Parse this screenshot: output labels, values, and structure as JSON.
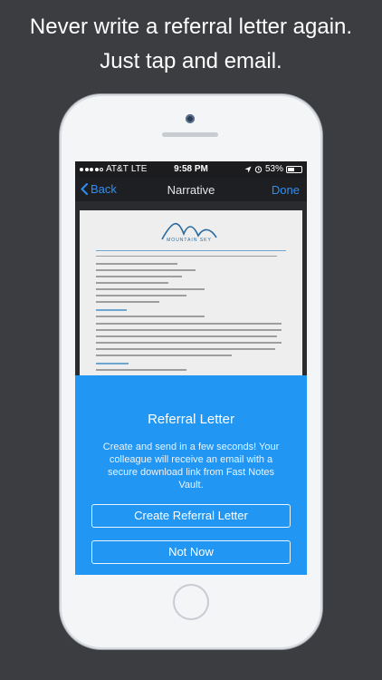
{
  "headline": {
    "line1": "Never write a referral letter again.",
    "line2": "Just tap and email."
  },
  "status_bar": {
    "carrier": "AT&T",
    "network": "LTE",
    "time": "9:58 PM",
    "battery": "53%",
    "battery_level_percent": 53
  },
  "nav": {
    "back_label": "Back",
    "title": "Narrative",
    "done_label": "Done"
  },
  "modal": {
    "title": "Referral Letter",
    "body": "Create and send in a few seconds! Your colleague will receive an email with a secure download link from Fast Notes Vault.",
    "primary_button": "Create Referral Letter",
    "secondary_button": "Not Now"
  },
  "document": {
    "logo_text": "MOUNTAIN SKY"
  },
  "colors": {
    "background": "#3b3d40",
    "accent": "#2f8ff0",
    "modal": "#2196f3"
  },
  "icons": [
    "back-chevron-icon",
    "location-icon",
    "alarm-icon",
    "battery-icon",
    "signal-dots-icon"
  ]
}
